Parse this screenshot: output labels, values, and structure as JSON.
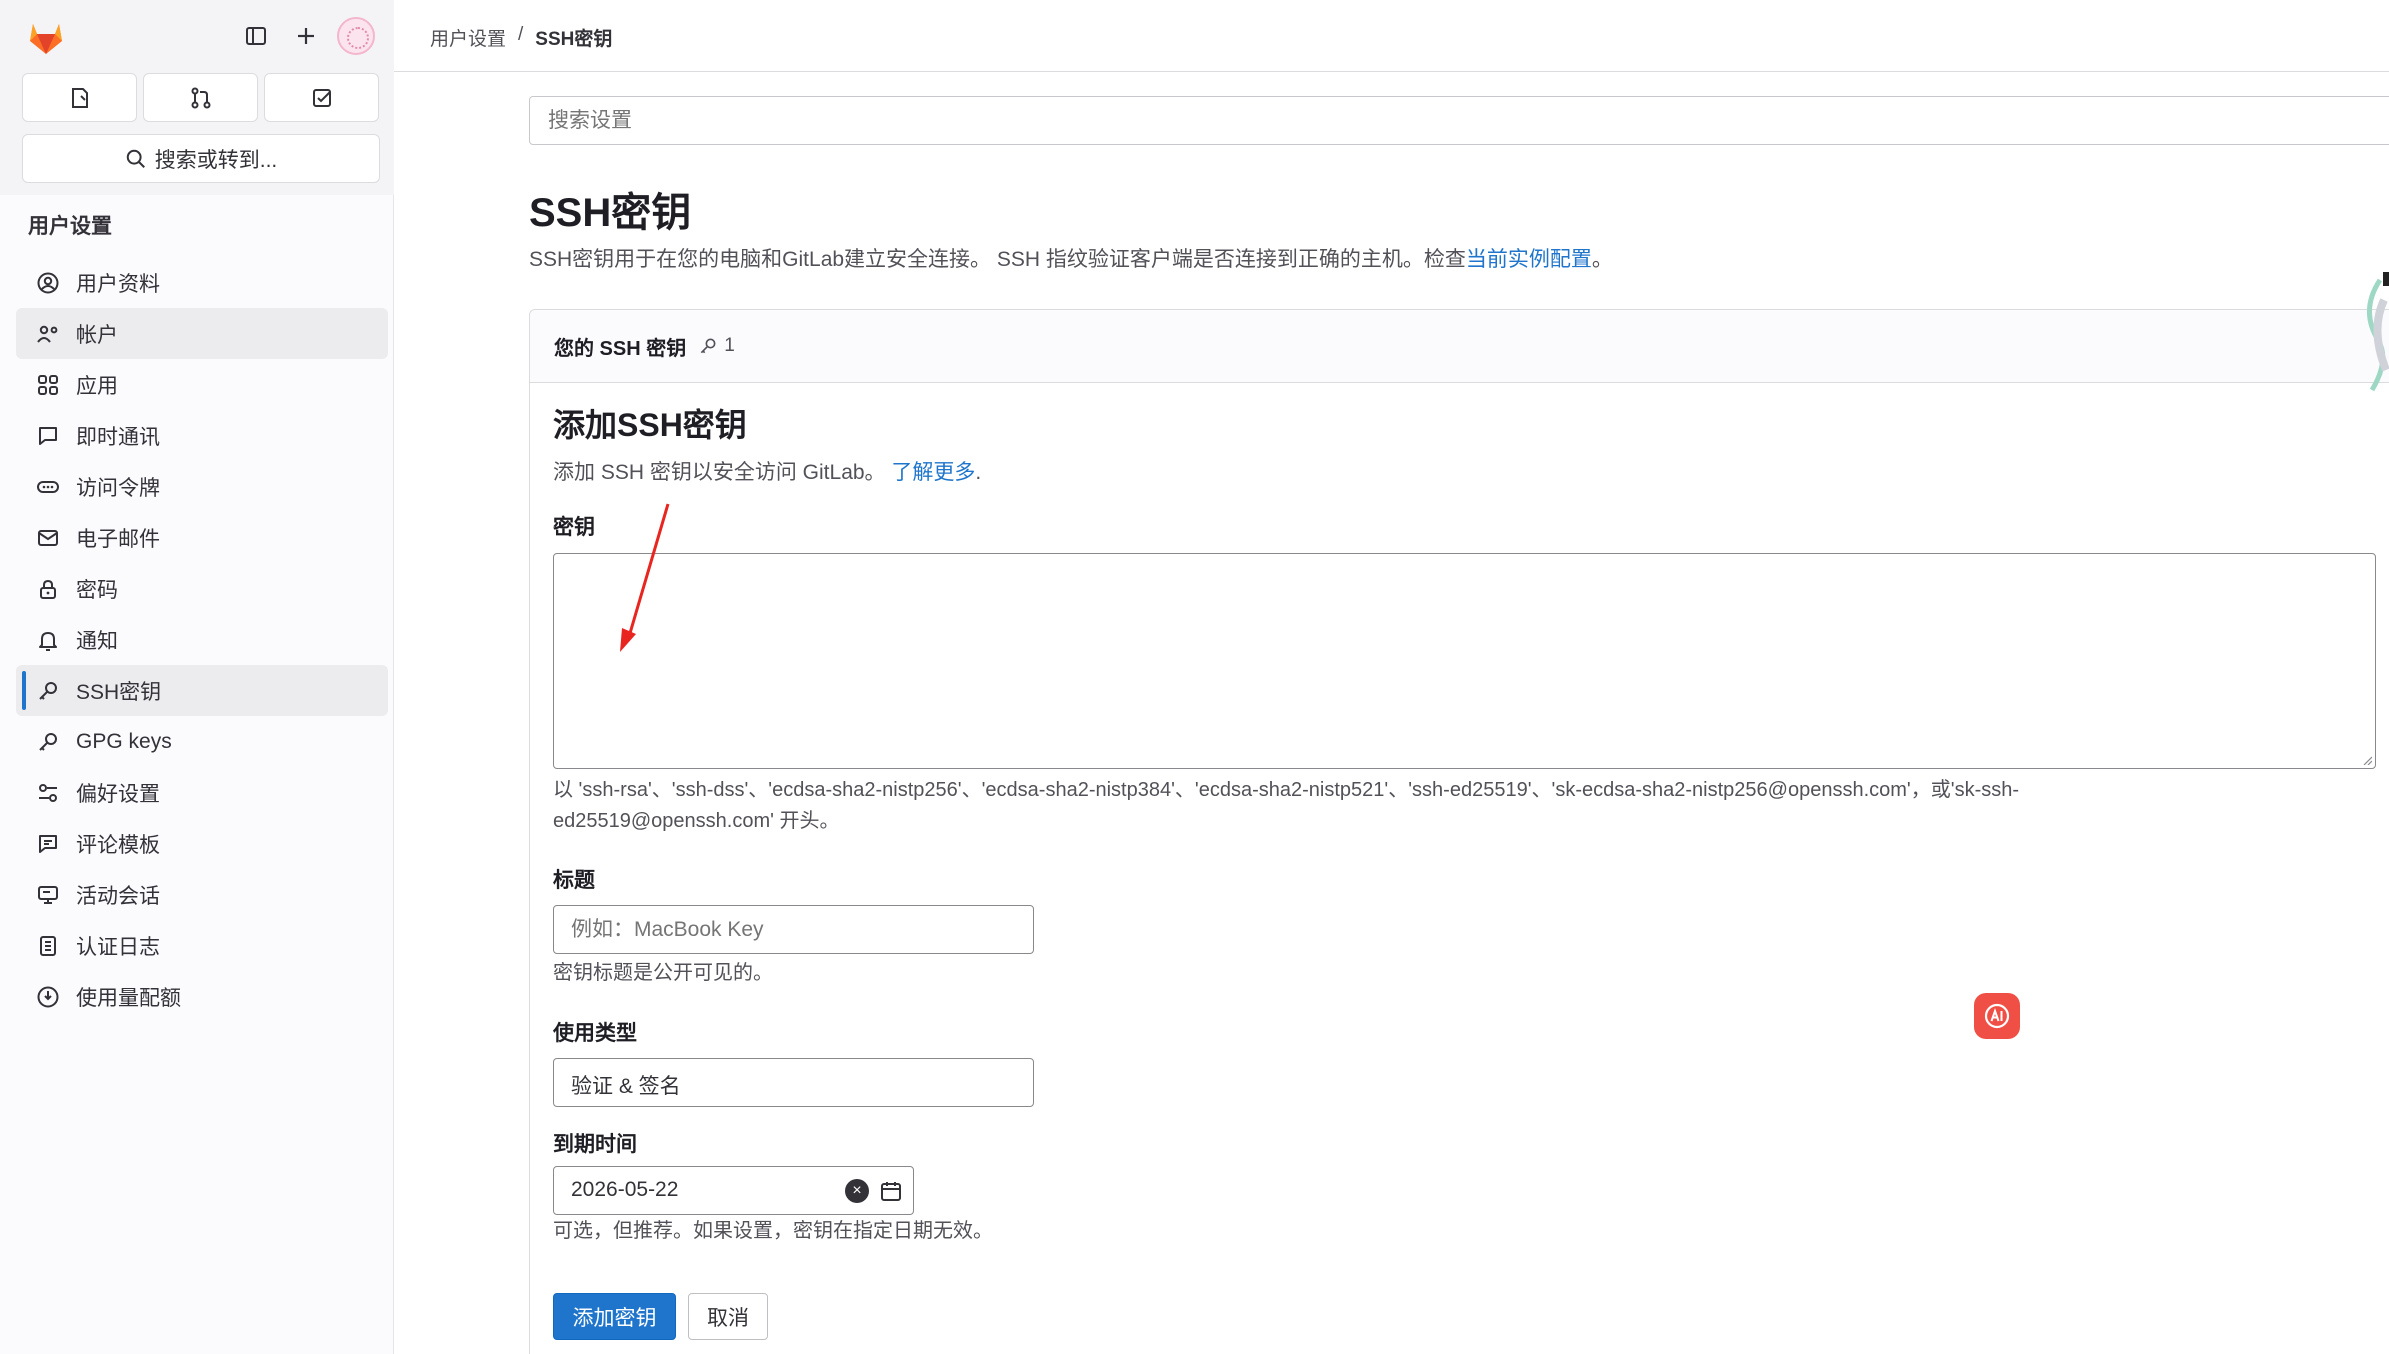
{
  "sidebar": {
    "search_label": "搜索或转到...",
    "section_title": "用户设置",
    "items": [
      {
        "label": "用户资料",
        "icon": "user-circle-icon"
      },
      {
        "label": "帐户",
        "icon": "account-settings-icon"
      },
      {
        "label": "应用",
        "icon": "apps-grid-icon"
      },
      {
        "label": "即时通讯",
        "icon": "chat-bubble-icon"
      },
      {
        "label": "访问令牌",
        "icon": "token-icon"
      },
      {
        "label": "电子邮件",
        "icon": "mail-icon"
      },
      {
        "label": "密码",
        "icon": "lock-icon"
      },
      {
        "label": "通知",
        "icon": "bell-icon"
      },
      {
        "label": "SSH密钥",
        "icon": "key-icon"
      },
      {
        "label": "GPG keys",
        "icon": "key-icon"
      },
      {
        "label": "偏好设置",
        "icon": "preferences-icon"
      },
      {
        "label": "评论模板",
        "icon": "comment-template-icon"
      },
      {
        "label": "活动会话",
        "icon": "monitor-icon"
      },
      {
        "label": "认证日志",
        "icon": "log-icon"
      },
      {
        "label": "使用量配额",
        "icon": "quota-icon"
      }
    ]
  },
  "breadcrumb": {
    "parent": "用户设置",
    "separator": "/",
    "current": "SSH密钥"
  },
  "search_settings": {
    "placeholder": "搜索设置"
  },
  "page": {
    "title": "SSH密钥",
    "description": "SSH密钥用于在您的电脑和GitLab建立安全连接。 SSH 指纹验证客户端是否连接到正确的主机。检查",
    "description_link": "当前实例配置",
    "description_end": "。"
  },
  "card": {
    "title": "您的 SSH 密钥",
    "count": "1",
    "form_title": "添加SSH密钥",
    "form_sub": "添加 SSH 密钥以安全访问 GitLab。",
    "form_sub_link": "了解更多",
    "form_sub_end": ".",
    "key_label": "密钥",
    "key_value": "",
    "key_hint_line1": "以 'ssh-rsa'、'ssh-dss'、'ecdsa-sha2-nistp256'、'ecdsa-sha2-nistp384'、'ecdsa-sha2-nistp521'、'ssh-ed25519'、'sk-ecdsa-sha2-nistp256@openssh.com'，或'sk-ssh-",
    "key_hint_line2": "ed25519@openssh.com' 开头。",
    "title_label": "标题",
    "title_placeholder": "例如：MacBook Key",
    "title_hint": "密钥标题是公开可见的。",
    "usage_label": "使用类型",
    "usage_value": "验证 & 签名",
    "expiry_label": "到期时间",
    "expiry_value": "2026-05-22",
    "expiry_hint": "可选，但推荐。如果设置，密钥在指定日期无效。",
    "submit_label": "添加密钥",
    "cancel_label": "取消"
  },
  "colors": {
    "primary": "#1f75cb",
    "ai_button": "#f04f45",
    "annotation_arrow": "#e8251f"
  }
}
